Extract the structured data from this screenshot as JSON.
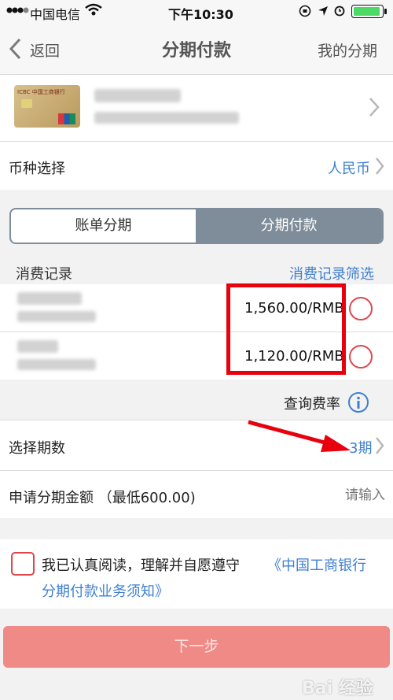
{
  "status_bar": {
    "carrier": "中国电信",
    "time": "下午10:30"
  },
  "nav": {
    "back_label": "返回",
    "title": "分期付款",
    "right_label": "我的分期"
  },
  "card": {
    "logo_text": "ICBC 中国工商银行"
  },
  "currency": {
    "label": "币种选择",
    "value": "人民币"
  },
  "segments": {
    "bill": "账单分期",
    "installment": "分期付款"
  },
  "records": {
    "header": "消费记录",
    "filter": "消费记录筛选",
    "items": [
      {
        "amount": "1,560.00/RMB"
      },
      {
        "amount": "1,120.00/RMB"
      }
    ]
  },
  "rate_query": "查询费率",
  "period": {
    "label": "选择期数",
    "value": "3期"
  },
  "amount": {
    "label": "申请分期金额 （最低600.00)",
    "placeholder": "请输入"
  },
  "agreement": {
    "text": "我已认真阅读，理解并自愿遵守",
    "link_line1": "《中国工商银行",
    "link_line2": "分期付款业务须知》"
  },
  "next_button": "下一步",
  "watermark": "Bai 经验",
  "colors": {
    "accent_blue": "#3f7fd0",
    "segment_selected": "#7f8c99",
    "button_disabled": "#f08a86",
    "annotation_red": "#e8000d"
  }
}
